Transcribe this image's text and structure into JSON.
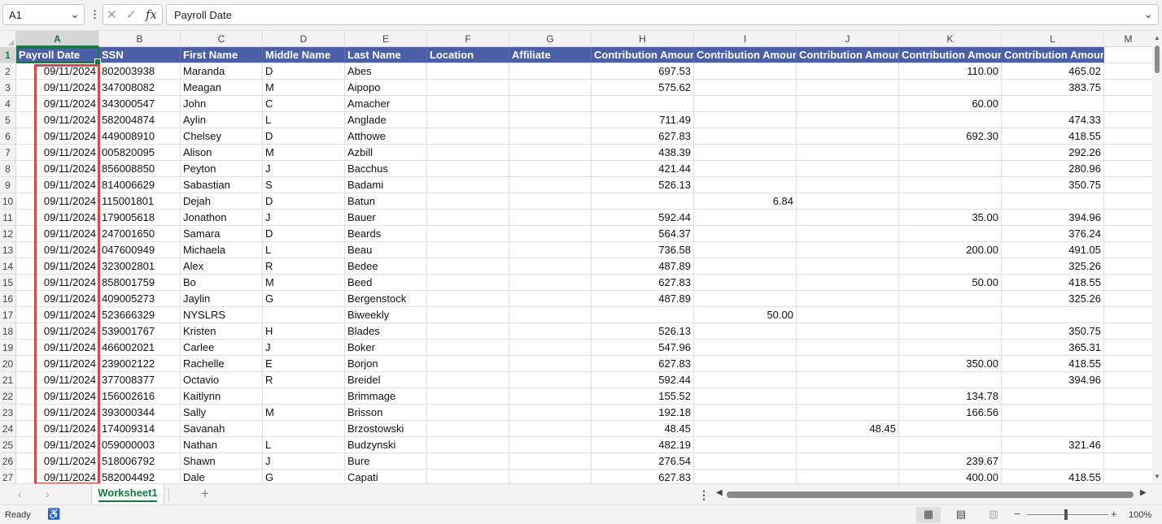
{
  "formula_bar": {
    "name_box": "A1",
    "formula": "Payroll Date"
  },
  "columns": [
    "A",
    "B",
    "C",
    "D",
    "E",
    "F",
    "G",
    "H",
    "I",
    "J",
    "K",
    "L",
    "M"
  ],
  "headers": [
    "Payroll Date",
    "SSN",
    "First Name",
    "Middle Name",
    "Last Name",
    "Location",
    "Affiliate",
    "Contribution Amount",
    "Contribution Amount",
    "Contribution Amount",
    "Contribution Amount",
    "Contribution Amount"
  ],
  "rows": [
    {
      "n": "2",
      "d": "09/11/2024",
      "ssn": "802003938",
      "first": "Maranda",
      "mid": "D",
      "last": "Abes",
      "h": "697.53",
      "i": "",
      "j": "",
      "k": "110.00",
      "l": "465.02"
    },
    {
      "n": "3",
      "d": "09/11/2024",
      "ssn": "347008082",
      "first": "Meagan",
      "mid": "M",
      "last": "Aipopo",
      "h": "575.62",
      "i": "",
      "j": "",
      "k": "",
      "l": "383.75"
    },
    {
      "n": "4",
      "d": "09/11/2024",
      "ssn": "343000547",
      "first": "John",
      "mid": "C",
      "last": "Amacher",
      "h": "",
      "i": "",
      "j": "",
      "k": "60.00",
      "l": ""
    },
    {
      "n": "5",
      "d": "09/11/2024",
      "ssn": "582004874",
      "first": "Aylin",
      "mid": "L",
      "last": "Anglade",
      "h": "711.49",
      "i": "",
      "j": "",
      "k": "",
      "l": "474.33"
    },
    {
      "n": "6",
      "d": "09/11/2024",
      "ssn": "449008910",
      "first": "Chelsey",
      "mid": "D",
      "last": "Atthowe",
      "h": "627.83",
      "i": "",
      "j": "",
      "k": "692.30",
      "l": "418.55"
    },
    {
      "n": "7",
      "d": "09/11/2024",
      "ssn": "005820095",
      "first": "Alison",
      "mid": "M",
      "last": "Azbill",
      "h": "438.39",
      "i": "",
      "j": "",
      "k": "",
      "l": "292.26"
    },
    {
      "n": "8",
      "d": "09/11/2024",
      "ssn": "856008850",
      "first": "Peyton",
      "mid": "J",
      "last": "Bacchus",
      "h": "421.44",
      "i": "",
      "j": "",
      "k": "",
      "l": "280.96"
    },
    {
      "n": "9",
      "d": "09/11/2024",
      "ssn": "814006629",
      "first": "Sabastian",
      "mid": "S",
      "last": "Badami",
      "h": "526.13",
      "i": "",
      "j": "",
      "k": "",
      "l": "350.75"
    },
    {
      "n": "10",
      "d": "09/11/2024",
      "ssn": "115001801",
      "first": "Dejah",
      "mid": "D",
      "last": "Batun",
      "h": "",
      "i": "6.84",
      "j": "",
      "k": "",
      "l": ""
    },
    {
      "n": "11",
      "d": "09/11/2024",
      "ssn": "179005618",
      "first": "Jonathon",
      "mid": "J",
      "last": "Bauer",
      "h": "592.44",
      "i": "",
      "j": "",
      "k": "35.00",
      "l": "394.96"
    },
    {
      "n": "12",
      "d": "09/11/2024",
      "ssn": "247001650",
      "first": "Samara",
      "mid": "D",
      "last": "Beards",
      "h": "564.37",
      "i": "",
      "j": "",
      "k": "",
      "l": "376.24"
    },
    {
      "n": "13",
      "d": "09/11/2024",
      "ssn": "047600949",
      "first": "Michaela",
      "mid": "L",
      "last": "Beau",
      "h": "736.58",
      "i": "",
      "j": "",
      "k": "200.00",
      "l": "491.05"
    },
    {
      "n": "14",
      "d": "09/11/2024",
      "ssn": "323002801",
      "first": "Alex",
      "mid": "R",
      "last": "Bedee",
      "h": "487.89",
      "i": "",
      "j": "",
      "k": "",
      "l": "325.26"
    },
    {
      "n": "15",
      "d": "09/11/2024",
      "ssn": "858001759",
      "first": "Bo",
      "mid": "M",
      "last": "Beed",
      "h": "627.83",
      "i": "",
      "j": "",
      "k": "50.00",
      "l": "418.55"
    },
    {
      "n": "16",
      "d": "09/11/2024",
      "ssn": "409005273",
      "first": "Jaylin",
      "mid": "G",
      "last": "Bergenstock",
      "h": "487.89",
      "i": "",
      "j": "",
      "k": "",
      "l": "325.26"
    },
    {
      "n": "17",
      "d": "09/11/2024",
      "ssn": "523666329",
      "first": "NYSLRS",
      "mid": "",
      "last": "Biweekly",
      "h": "",
      "i": "50.00",
      "j": "",
      "k": "",
      "l": ""
    },
    {
      "n": "18",
      "d": "09/11/2024",
      "ssn": "539001767",
      "first": "Kristen",
      "mid": "H",
      "last": "Blades",
      "h": "526.13",
      "i": "",
      "j": "",
      "k": "",
      "l": "350.75"
    },
    {
      "n": "19",
      "d": "09/11/2024",
      "ssn": "466002021",
      "first": "Carlee",
      "mid": "J",
      "last": "Boker",
      "h": "547.96",
      "i": "",
      "j": "",
      "k": "",
      "l": "365.31"
    },
    {
      "n": "20",
      "d": "09/11/2024",
      "ssn": "239002122",
      "first": "Rachelle",
      "mid": "E",
      "last": "Borjon",
      "h": "627.83",
      "i": "",
      "j": "",
      "k": "350.00",
      "l": "418.55"
    },
    {
      "n": "21",
      "d": "09/11/2024",
      "ssn": "377008377",
      "first": "Octavio",
      "mid": "R",
      "last": "Breidel",
      "h": "592.44",
      "i": "",
      "j": "",
      "k": "",
      "l": "394.96"
    },
    {
      "n": "22",
      "d": "09/11/2024",
      "ssn": "156002616",
      "first": "Kaitlynn",
      "mid": "",
      "last": "Brimmage",
      "h": "155.52",
      "i": "",
      "j": "",
      "k": "134.78",
      "l": ""
    },
    {
      "n": "23",
      "d": "09/11/2024",
      "ssn": "393000344",
      "first": "Sally",
      "mid": "M",
      "last": "Brisson",
      "h": "192.18",
      "i": "",
      "j": "",
      "k": "166.56",
      "l": ""
    },
    {
      "n": "24",
      "d": "09/11/2024",
      "ssn": "174009314",
      "first": "Savanah",
      "mid": "",
      "last": "Brzostowski",
      "h": "48.45",
      "i": "",
      "j": "48.45",
      "k": "",
      "l": ""
    },
    {
      "n": "25",
      "d": "09/11/2024",
      "ssn": "059000003",
      "first": "Nathan",
      "mid": "L",
      "last": "Budzynski",
      "h": "482.19",
      "i": "",
      "j": "",
      "k": "",
      "l": "321.46"
    },
    {
      "n": "26",
      "d": "09/11/2024",
      "ssn": "518006792",
      "first": "Shawn",
      "mid": "J",
      "last": "Bure",
      "h": "276.54",
      "i": "",
      "j": "",
      "k": "239.67",
      "l": ""
    },
    {
      "n": "27",
      "d": "09/11/2024",
      "ssn": "582004492",
      "first": "Dale",
      "mid": "G",
      "last": "Capati",
      "h": "627.83",
      "i": "",
      "j": "",
      "k": "400.00",
      "l": "418.55"
    }
  ],
  "sheet_tabs": [
    "Worksheet1"
  ],
  "status": {
    "ready": "Ready",
    "zoom": "100%"
  },
  "colors": {
    "header_fill": "#4a5fa8",
    "accent_green": "#107c41",
    "highlight_red": "#e0463f"
  }
}
